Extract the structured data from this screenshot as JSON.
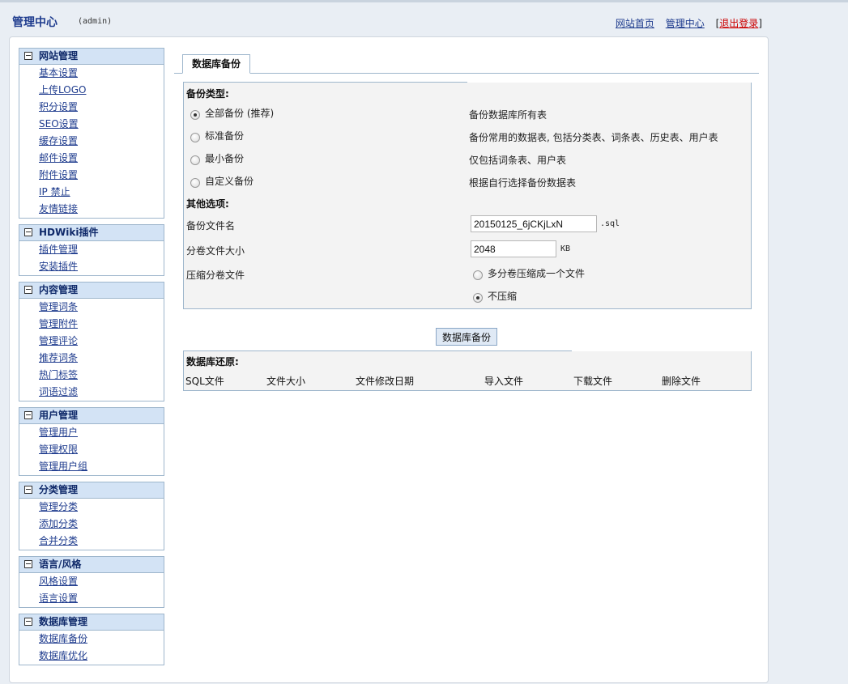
{
  "header": {
    "title": "管理中心",
    "user": "(admin)",
    "links": {
      "home": "网站首页",
      "admin": "管理中心",
      "logout_open": "[",
      "logout": "退出登录",
      "logout_close": "]"
    }
  },
  "sidebar": {
    "groups": [
      {
        "title": "网站管理",
        "items": [
          "基本设置",
          "上传LOGO",
          "积分设置",
          "SEO设置",
          "缓存设置",
          "邮件设置",
          "附件设置",
          "IP 禁止",
          "友情链接"
        ]
      },
      {
        "title": "HDWiki插件",
        "items": [
          "插件管理",
          "安装插件"
        ]
      },
      {
        "title": "内容管理",
        "items": [
          "管理词条",
          "管理附件",
          "管理评论",
          "推荐词条",
          "热门标签",
          "词语过滤"
        ]
      },
      {
        "title": "用户管理",
        "items": [
          "管理用户",
          "管理权限",
          "管理用户组"
        ]
      },
      {
        "title": "分类管理",
        "items": [
          "管理分类",
          "添加分类",
          "合并分类"
        ]
      },
      {
        "title": "语言/风格",
        "items": [
          "风格设置",
          "语言设置"
        ]
      },
      {
        "title": "数据库管理",
        "items": [
          "数据库备份",
          "数据库优化"
        ]
      }
    ]
  },
  "tab": {
    "label": "数据库备份"
  },
  "backup": {
    "type_label": "备份类型:",
    "options": [
      {
        "label": "全部备份 (推荐)",
        "desc": "备份数据库所有表",
        "selected": true
      },
      {
        "label": "标准备份",
        "desc": "备份常用的数据表, 包括分类表、词条表、历史表、用户表",
        "selected": false
      },
      {
        "label": "最小备份",
        "desc": "仅包括词条表、用户表",
        "selected": false
      },
      {
        "label": "自定义备份",
        "desc": "根据自行选择备份数据表",
        "selected": false
      }
    ],
    "other_label": "其他选项:",
    "filename_label": "备份文件名",
    "filename_value": "20150125_6jCKjLxN",
    "filename_ext": ".sql",
    "volume_label": "分卷文件大小",
    "volume_value": "2048",
    "volume_unit": "KB",
    "compress_label": "压缩分卷文件",
    "compress_options": [
      {
        "label": "多分卷压缩成一个文件",
        "selected": false
      },
      {
        "label": "不压缩",
        "selected": true
      }
    ]
  },
  "submit_label": "数据库备份",
  "restore": {
    "title": "数据库还原:",
    "columns": [
      "SQL文件",
      "文件大小",
      "文件修改日期",
      "导入文件",
      "下载文件",
      "删除文件"
    ]
  }
}
